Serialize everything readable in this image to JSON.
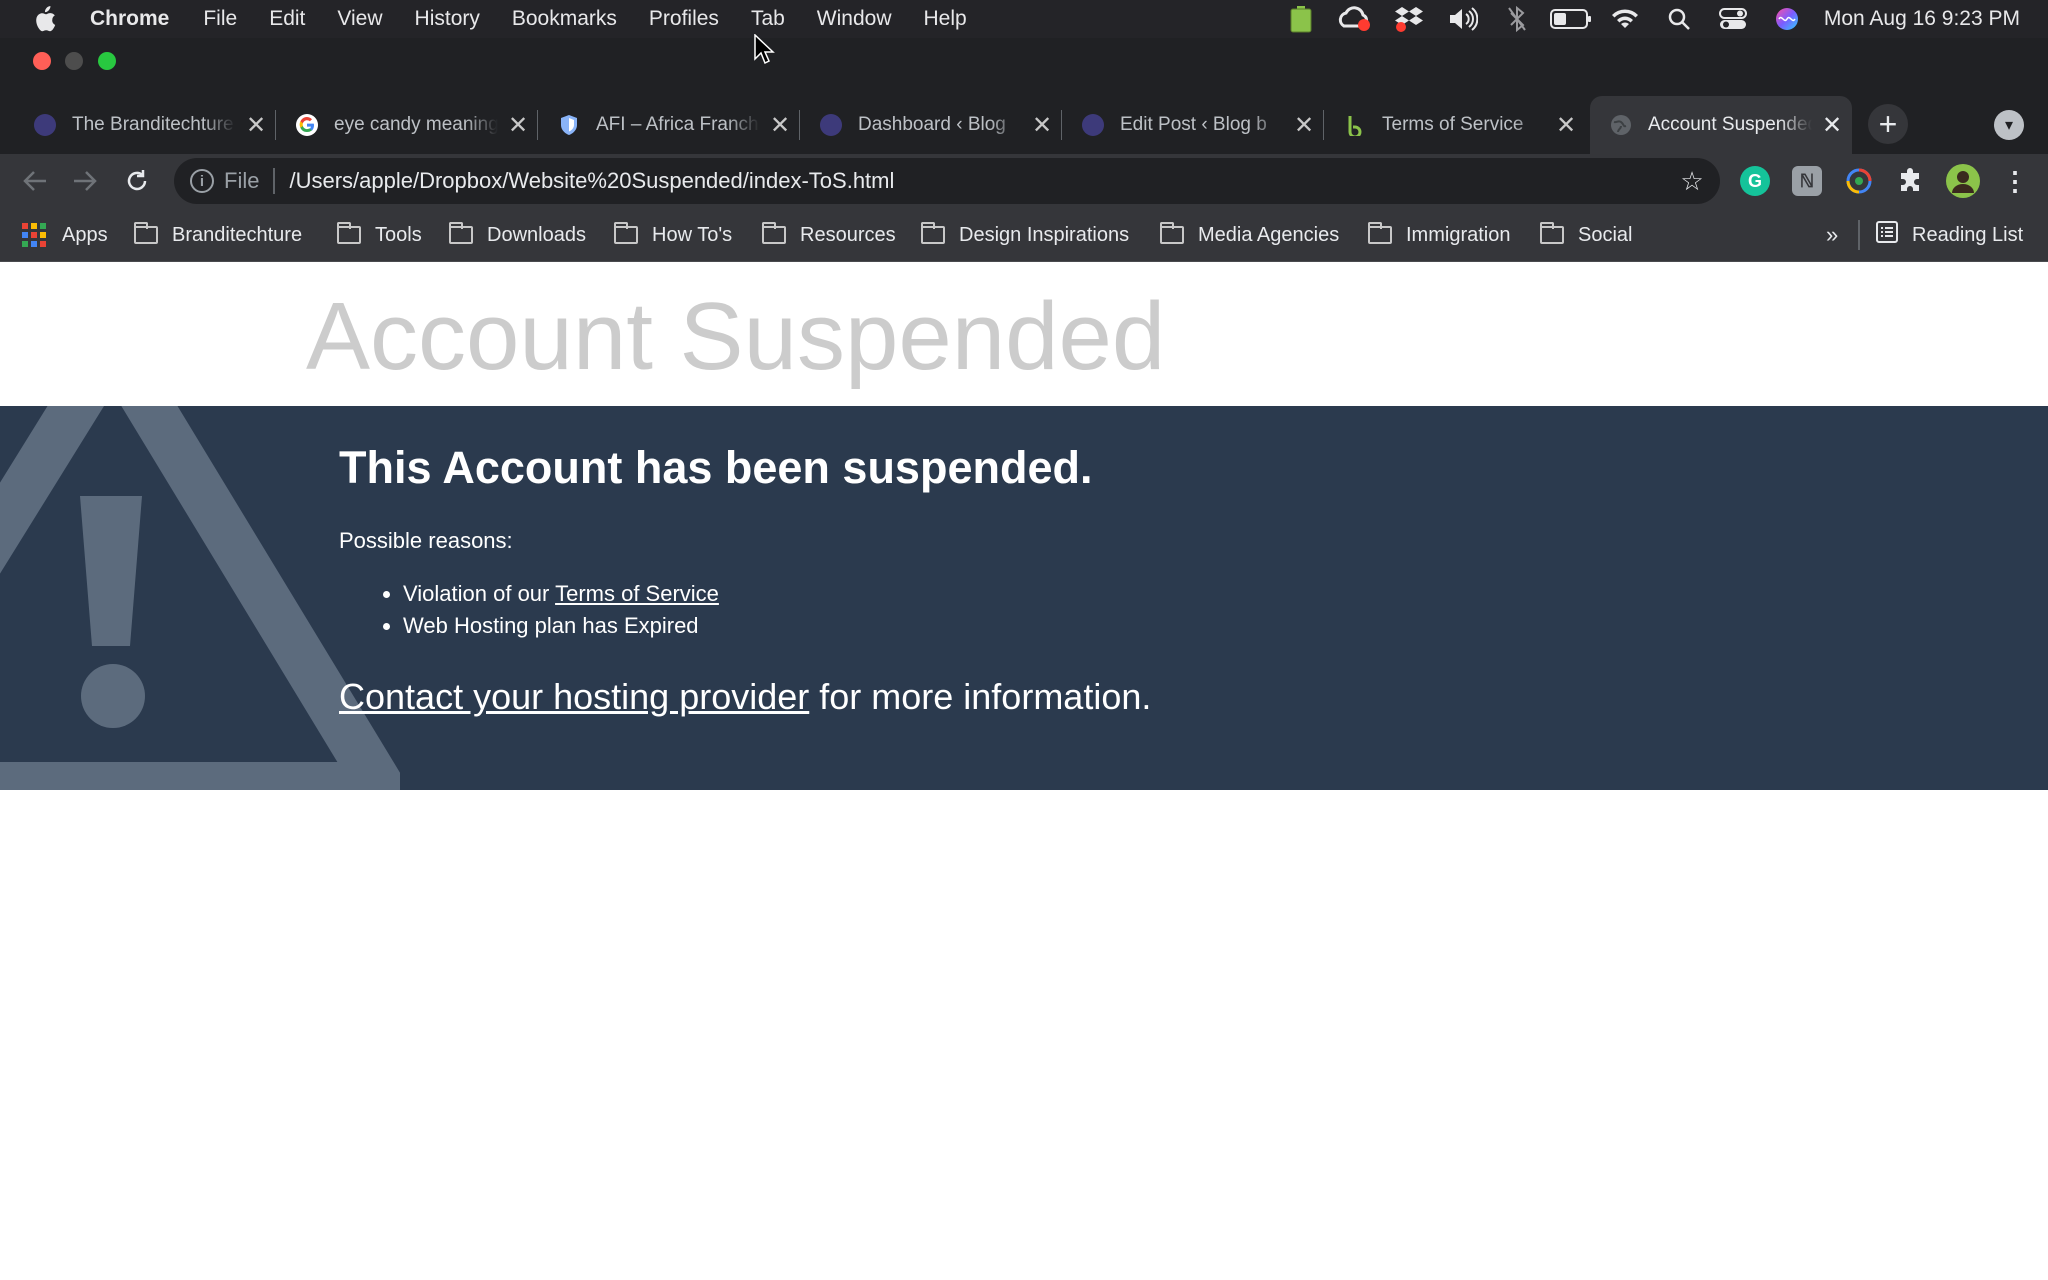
{
  "menubar": {
    "app_name": "Chrome",
    "items": [
      "File",
      "Edit",
      "View",
      "History",
      "Bookmarks",
      "Profiles",
      "Tab",
      "Window",
      "Help"
    ],
    "status_icons": [
      "battery-app-icon",
      "creative-cloud-icon",
      "dropbox-icon",
      "volume-icon",
      "bluetooth-icon",
      "battery-icon",
      "wifi-icon",
      "spotlight-icon",
      "control-center-icon",
      "siri-icon"
    ],
    "clock": "Mon Aug 16  9:23 PM"
  },
  "tabs": [
    {
      "title": "The Branditechture",
      "favicon": "circle-indigo",
      "color": "#3d3a7a",
      "active": false
    },
    {
      "title": "eye candy meaning",
      "favicon": "google-g",
      "color": "#ffffff",
      "active": false
    },
    {
      "title": "AFI – Africa Franchise",
      "favicon": "shield",
      "color": "#8ab4f8",
      "active": false
    },
    {
      "title": "Dashboard ‹ Blog",
      "favicon": "circle-indigo",
      "color": "#3d3a7a",
      "active": false
    },
    {
      "title": "Edit Post ‹ Blog b",
      "favicon": "circle-indigo",
      "color": "#3d3a7a",
      "active": false
    },
    {
      "title": "Terms of Service",
      "favicon": "b-green",
      "color": "#8bc34a",
      "active": false
    },
    {
      "title": "Account Suspended",
      "favicon": "globe",
      "color": "#5f6368",
      "active": true
    }
  ],
  "toolbar": {
    "scheme": "File",
    "url": "/Users/apple/Dropbox/Website%20Suspended/index-ToS.html"
  },
  "extensions": [
    {
      "name": "grammarly-icon",
      "glyph": "G",
      "color": "#15c39a"
    },
    {
      "name": "notion-icon",
      "glyph": "ℕ",
      "color": "#9aa0a6"
    },
    {
      "name": "colorful-extension-icon",
      "glyph": "◎",
      "color": "#4285f4"
    },
    {
      "name": "puzzle-extensions-icon",
      "glyph": "✣",
      "color": "#e8eaed"
    }
  ],
  "bookmarks": {
    "apps_label": "Apps",
    "folders": [
      "Branditechture",
      "Tools",
      "Downloads",
      "How To's",
      "Resources",
      "Design Inspirations",
      "Media Agencies",
      "Immigration",
      "Social"
    ],
    "overflow": "»",
    "reading_list": "Reading List"
  },
  "page": {
    "title": "Account Suspended",
    "heading": "This Account has been suspended.",
    "reasons_label": "Possible reasons:",
    "reason_1_prefix": "Violation of our ",
    "reason_1_link": "Terms of Service",
    "reason_2": "Web Hosting plan has Expired",
    "contact_link": "Contact your hosting provider",
    "contact_suffix": " for more information."
  },
  "colors": {
    "banner_bg": "#2b3a4e",
    "title_gray": "#cccccc",
    "close_red": "#ff5f57",
    "minimize_gray": "#4d4d4d",
    "zoom_green": "#28c840"
  }
}
